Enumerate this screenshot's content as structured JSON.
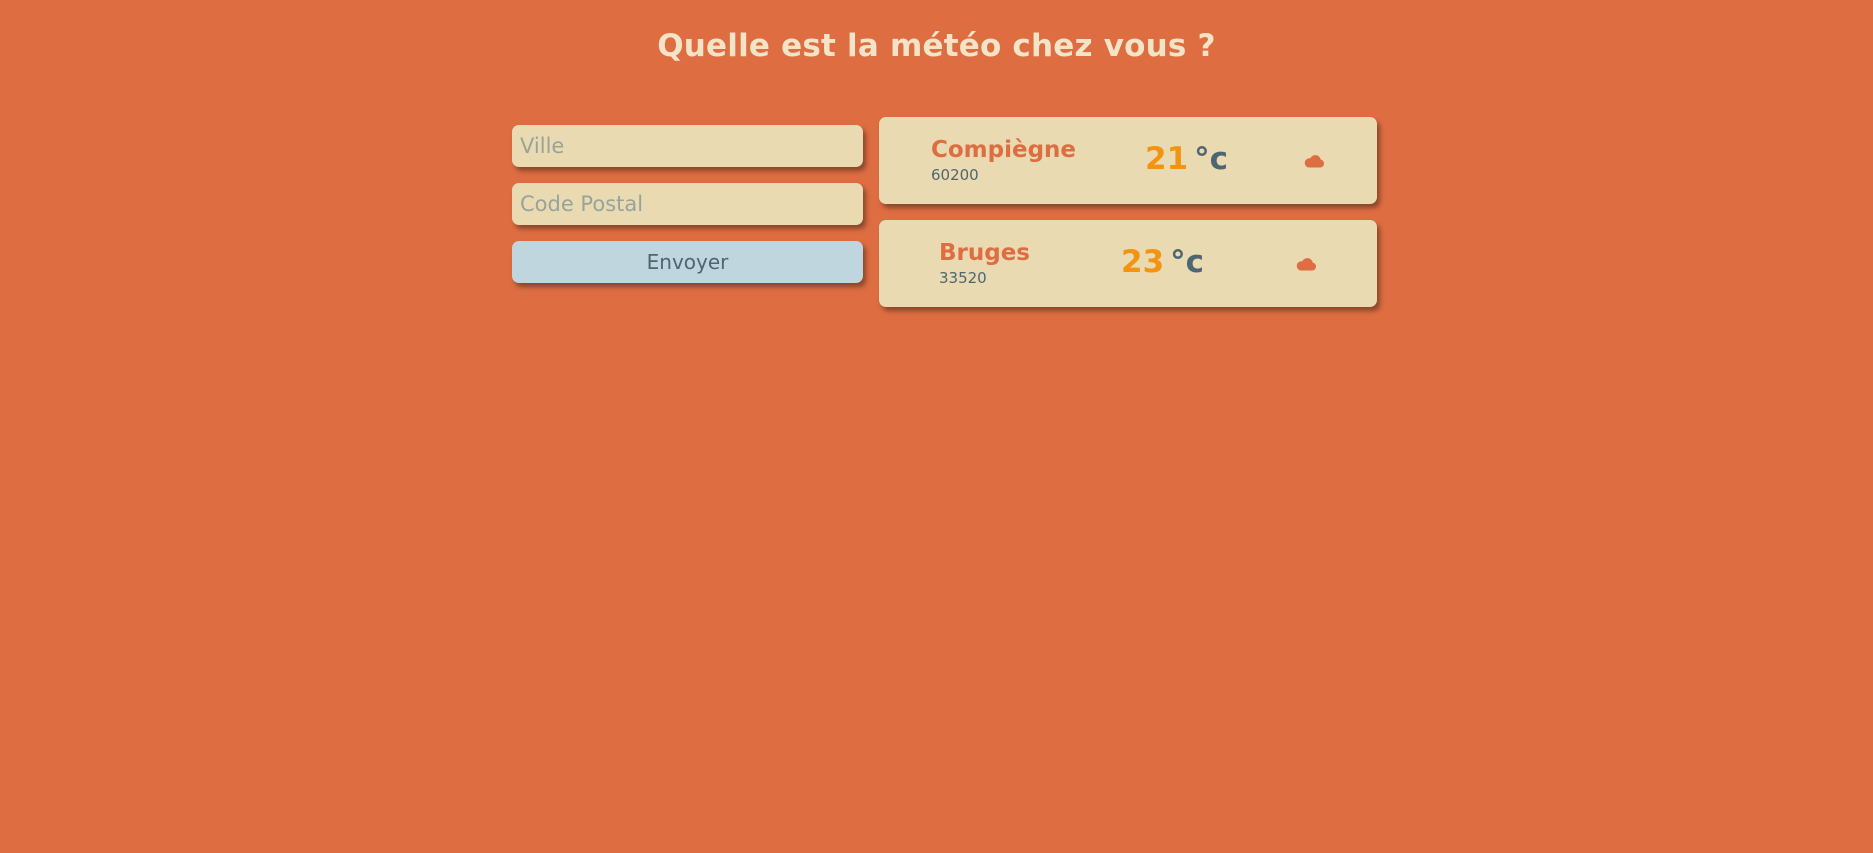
{
  "page": {
    "title": "Quelle est la météo chez vous ?"
  },
  "form": {
    "city_placeholder": "Ville",
    "zip_placeholder": "Code Postal",
    "submit_label": "Envoyer"
  },
  "cards": [
    {
      "city": "Compiègne",
      "zip": "60200",
      "temperature": "21",
      "unit": "°c",
      "icon": "cloud-icon"
    },
    {
      "city": "Bruges",
      "zip": "33520",
      "temperature": "23",
      "unit": "°c",
      "icon": "cloud-icon"
    }
  ],
  "colors": {
    "background": "#de6d42",
    "card": "#e9dab1",
    "button": "#bfd6de",
    "temperature": "#f29412",
    "city": "#de6d42",
    "text": "#4e6672",
    "title": "#f3e4c8"
  }
}
